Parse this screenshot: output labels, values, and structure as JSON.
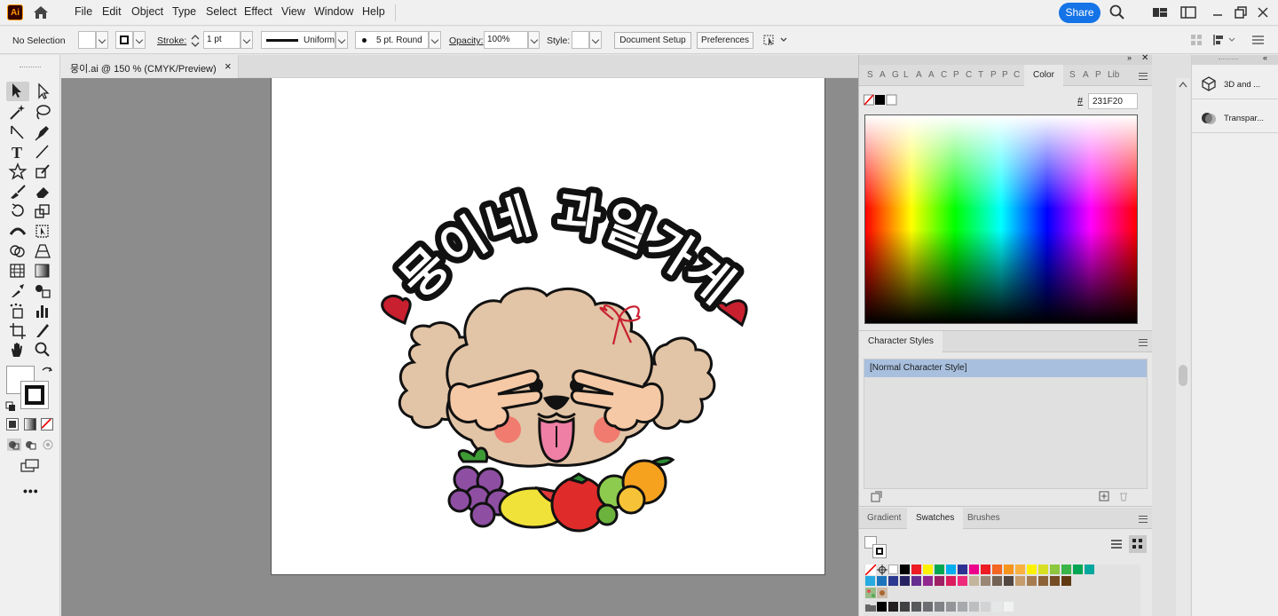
{
  "menubar": {
    "logo": "Ai",
    "items": [
      "File",
      "Edit",
      "Object",
      "Type",
      "Select",
      "Effect",
      "View",
      "Window",
      "Help"
    ],
    "share_label": "Share"
  },
  "control": {
    "selection": "No Selection",
    "stroke_label": "Stroke:",
    "stroke_value": "1 pt",
    "profile": "Uniform",
    "brush": "5 pt. Round",
    "opacity_label": "Opacity:",
    "opacity_value": "100%",
    "style_label": "Style:",
    "document_setup": "Document Setup",
    "preferences": "Preferences"
  },
  "document": {
    "tab_title": "뭉이.ai @ 150 % (CMYK/Preview)",
    "close": "×"
  },
  "artwork": {
    "title_text": "뭉이네 과일가게"
  },
  "color_panel": {
    "tabs": [
      "S",
      "A",
      "G",
      "L",
      "A",
      "A",
      "C",
      "P",
      "C",
      "T",
      "P",
      "P",
      "C"
    ],
    "active_tab": "Color",
    "extra_tabs": [
      "S",
      "A",
      "P",
      "Lib"
    ],
    "hex_label": "#",
    "hex_value": "231F20"
  },
  "character_styles": {
    "title": "Character Styles",
    "items": [
      "[Normal Character Style]"
    ]
  },
  "swatches_panel": {
    "tabs": [
      "Gradient",
      "Swatches",
      "Brushes"
    ],
    "active": "Swatches",
    "row1": [
      "#ffffff",
      "#000000",
      "#ed1c24",
      "#fff200",
      "#00a651",
      "#00aeef",
      "#2e3192",
      "#ec008c",
      "#ed1c24",
      "#f26522",
      "#f7941d",
      "#fbb040",
      "#fff200",
      "#d7df23",
      "#8dc63f",
      "#39b54a",
      "#00a651",
      "#00a79d"
    ],
    "row2": [
      "#27aae1",
      "#1c75bc",
      "#2b3990",
      "#262262",
      "#662d91",
      "#92278f",
      "#9e1f63",
      "#da1c5c",
      "#ee2a7b",
      "#c2b59b",
      "#998675",
      "#736357",
      "#534741",
      "#c69c6d",
      "#a67c52",
      "#8c6239",
      "#754c24",
      "#603913"
    ],
    "row3": [
      "#000000",
      "#231f20",
      "#414042",
      "#58595b",
      "#6d6e71",
      "#808285",
      "#939598",
      "#a7a9ac",
      "#bcbec0",
      "#d1d3d4",
      "#e6e7e8",
      "#f1f2f2"
    ]
  },
  "right_dock": {
    "items": [
      "3D and ...",
      "Transpar..."
    ]
  },
  "colors": {
    "accent": "#1473e6",
    "heart": "#c8202f",
    "dog_fur": "#e2c4a6",
    "tongue": "#ef7fa5",
    "cheek": "#f07b6e"
  }
}
